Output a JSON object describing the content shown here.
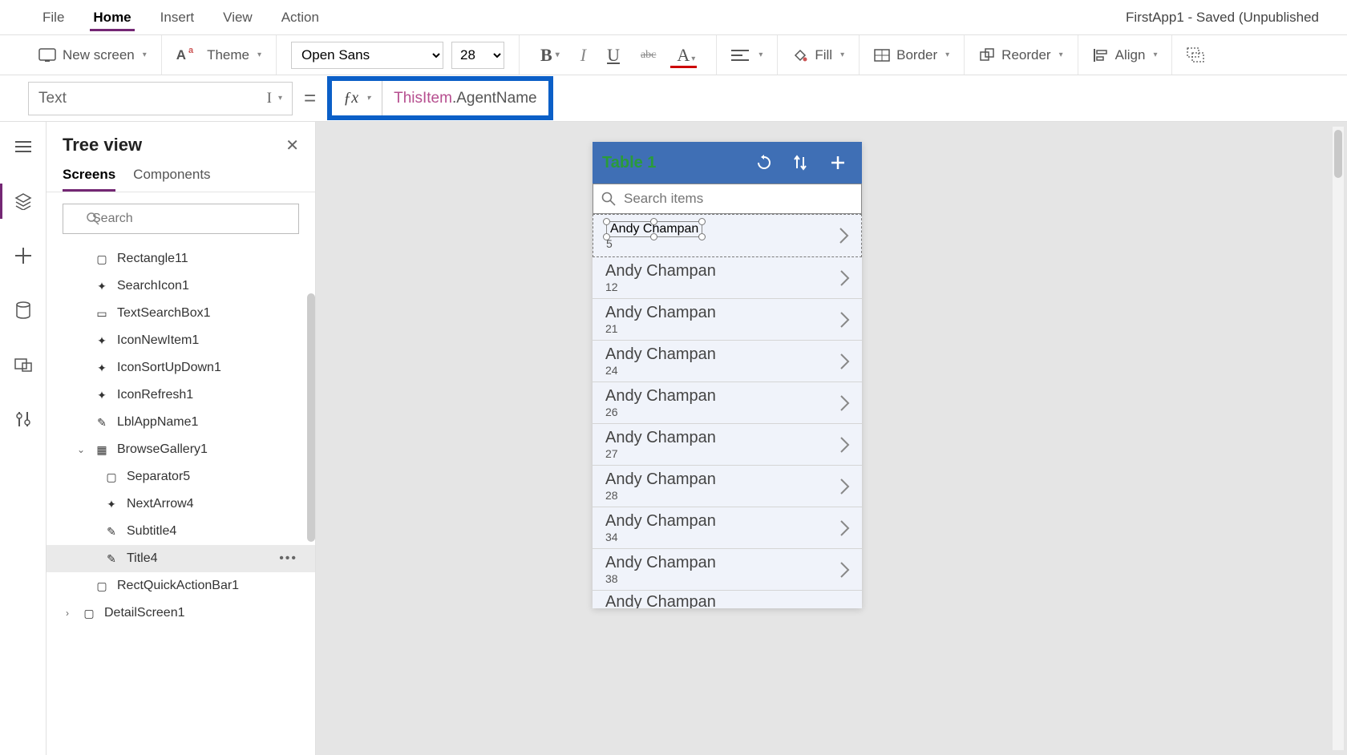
{
  "menu": {
    "file": "File",
    "home": "Home",
    "insert": "Insert",
    "view": "View",
    "action": "Action"
  },
  "app_title": "FirstApp1 - Saved (Unpublished",
  "ribbon": {
    "new_screen": "New screen",
    "theme": "Theme",
    "font": "Open Sans",
    "size": "28",
    "fill": "Fill",
    "border": "Border",
    "reorder": "Reorder",
    "align": "Align"
  },
  "formula": {
    "property": "Text",
    "token1": "ThisItem",
    "token2": ".AgentName"
  },
  "panel": {
    "title": "Tree view",
    "tab_screens": "Screens",
    "tab_components": "Components",
    "search_placeholder": "Search"
  },
  "tree": {
    "rectangle": "Rectangle11",
    "search_icon": "SearchIcon1",
    "text_search": "TextSearchBox1",
    "icon_new": "IconNewItem1",
    "icon_sort": "IconSortUpDown1",
    "icon_refresh": "IconRefresh1",
    "lbl_app": "LblAppName1",
    "gallery": "BrowseGallery1",
    "separator": "Separator5",
    "next_arrow": "NextArrow4",
    "subtitle": "Subtitle4",
    "title4": "Title4",
    "rect_quick": "RectQuickActionBar1",
    "detail": "DetailScreen1"
  },
  "phone": {
    "header_title": "Table 1",
    "search_placeholder": "Search items",
    "items": [
      {
        "name": "Andy Champan",
        "sub": "5"
      },
      {
        "name": "Andy Champan",
        "sub": "12"
      },
      {
        "name": "Andy Champan",
        "sub": "21"
      },
      {
        "name": "Andy Champan",
        "sub": "24"
      },
      {
        "name": "Andy Champan",
        "sub": "26"
      },
      {
        "name": "Andy Champan",
        "sub": "27"
      },
      {
        "name": "Andy Champan",
        "sub": "28"
      },
      {
        "name": "Andy Champan",
        "sub": "34"
      },
      {
        "name": "Andy Champan",
        "sub": "38"
      },
      {
        "name": "Andy Champan",
        "sub": ""
      }
    ]
  }
}
